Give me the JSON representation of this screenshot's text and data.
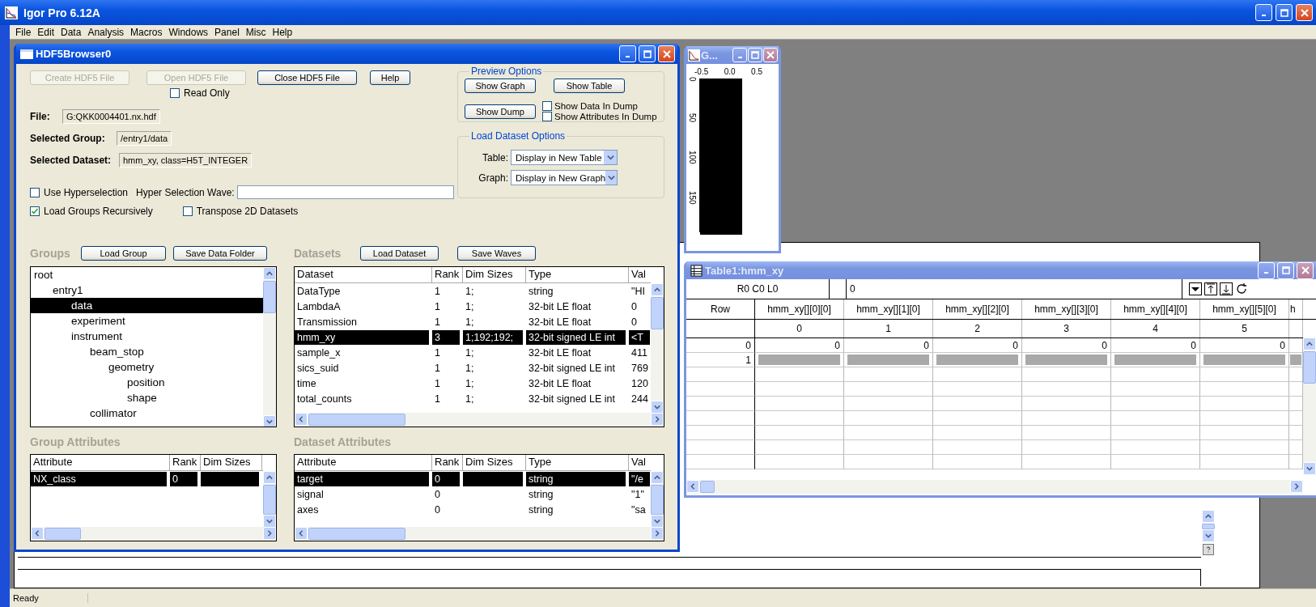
{
  "app": {
    "title": "Igor Pro 6.12A",
    "menu": [
      "File",
      "Edit",
      "Data",
      "Analysis",
      "Macros",
      "Windows",
      "Panel",
      "Misc",
      "Help"
    ]
  },
  "browser": {
    "title": "HDF5Browser0",
    "buttons": [
      {
        "label": "Create HDF5 File",
        "disabled": true
      },
      {
        "label": "Open HDF5 File",
        "disabled": true
      },
      {
        "label": "Close HDF5 File",
        "disabled": false
      },
      {
        "label": "Help",
        "disabled": false
      }
    ],
    "read_only": {
      "label": "Read Only",
      "checked": false
    },
    "fields": [
      {
        "label": "File:",
        "value": "G:QKK0004401.nx.hdf"
      },
      {
        "label": "Selected Group:",
        "value": "/entry1/data"
      },
      {
        "label": "Selected Dataset:",
        "value": "hmm_xy, class=H5T_INTEGER"
      }
    ],
    "use_hyperselection": {
      "label": "Use Hyperselection",
      "checked": false
    },
    "hyper_wave": {
      "label": "Hyper Selection Wave:"
    },
    "load_groups_recursively": {
      "label": "Load Groups Recursively",
      "checked": true
    },
    "transpose": {
      "label": "Transpose 2D Datasets",
      "checked": false
    },
    "preview_options": {
      "title": "Preview Options",
      "buttons": [
        "Show Graph",
        "Show Table",
        "Show Dump"
      ],
      "checkboxes": [
        {
          "label": "Show Data In Dump",
          "checked": false
        },
        {
          "label": "Show Attributes In Dump",
          "checked": false
        }
      ]
    },
    "load_options": {
      "title": "Load Dataset Options",
      "rows": [
        {
          "label": "Table:",
          "value": "Display in New Table"
        },
        {
          "label": "Graph:",
          "value": "Display in New Graph"
        }
      ]
    },
    "groups": {
      "title": "Groups",
      "buttons": [
        "Load Group",
        "Save Data Folder"
      ],
      "tree": [
        {
          "label": "root",
          "selected": false,
          "children": [
            {
              "label": "entry1",
              "selected": false,
              "children": [
                {
                  "label": "data",
                  "selected": true
                },
                {
                  "label": "experiment",
                  "selected": false
                },
                {
                  "label": "instrument",
                  "selected": false,
                  "children": [
                    {
                      "label": "beam_stop",
                      "selected": false,
                      "children": [
                        {
                          "label": "geometry",
                          "selected": false,
                          "children": [
                            {
                              "label": "position",
                              "selected": false
                            },
                            {
                              "label": "shape",
                              "selected": false
                            }
                          ]
                        }
                      ]
                    },
                    {
                      "label": "collimator",
                      "selected": false
                    }
                  ]
                }
              ]
            }
          ]
        }
      ]
    },
    "datasets": {
      "title": "Datasets",
      "buttons": [
        "Load Dataset",
        "Save Waves"
      ],
      "columns": [
        "Dataset",
        "Rank",
        "Dim Sizes",
        "Type",
        "Val"
      ],
      "rows": [
        {
          "cells": [
            "DataType",
            "1",
            "1;",
            "string",
            "\"HI"
          ],
          "selected": false
        },
        {
          "cells": [
            "LambdaA",
            "1",
            "1;",
            "32-bit LE float",
            "0"
          ],
          "selected": false
        },
        {
          "cells": [
            "Transmission",
            "1",
            "1;",
            "32-bit LE float",
            "0"
          ],
          "selected": false
        },
        {
          "cells": [
            "hmm_xy",
            "3",
            "1;192;192;",
            "32-bit signed LE int",
            "<T"
          ],
          "selected": true
        },
        {
          "cells": [
            "sample_x",
            "1",
            "1;",
            "32-bit LE float",
            "411"
          ],
          "selected": false
        },
        {
          "cells": [
            "sics_suid",
            "1",
            "1;",
            "32-bit signed LE int",
            "769"
          ],
          "selected": false
        },
        {
          "cells": [
            "time",
            "1",
            "1;",
            "32-bit LE float",
            "120"
          ],
          "selected": false
        },
        {
          "cells": [
            "total_counts",
            "1",
            "1;",
            "32-bit signed LE int",
            "244"
          ],
          "selected": false
        }
      ]
    },
    "group_attributes": {
      "title": "Group Attributes",
      "columns": [
        "Attribute",
        "Rank",
        "Dim Sizes"
      ],
      "rows": [
        {
          "cells": [
            "NX_class",
            "0"
          ],
          "selected": true
        }
      ]
    },
    "dataset_attributes": {
      "title": "Dataset Attributes",
      "columns": [
        "Attribute",
        "Rank",
        "Dim Sizes",
        "Type",
        "Val"
      ],
      "rows": [
        {
          "cells": [
            "target",
            "0",
            "",
            "string",
            "\"/e"
          ],
          "selected": true
        },
        {
          "cells": [
            "signal",
            "0",
            "",
            "string",
            "\"1\""
          ],
          "selected": false
        },
        {
          "cells": [
            "axes",
            "0",
            "",
            "string",
            "\"sa"
          ],
          "selected": false
        }
      ]
    }
  },
  "graph": {
    "title": "G...",
    "x_ticks": [
      "-0.5",
      "0.0",
      "0.5"
    ],
    "y_ticks": [
      "0",
      "50",
      "100",
      "150"
    ]
  },
  "table": {
    "title": "Table1:hmm_xy",
    "cell_info": "R0 C0 L0",
    "entry": "0",
    "row_header": "Row",
    "columns": [
      {
        "name": "hmm_xy[][0][0]",
        "index": "0"
      },
      {
        "name": "hmm_xy[][1][0]",
        "index": "1"
      },
      {
        "name": "hmm_xy[][2][0]",
        "index": "2"
      },
      {
        "name": "hmm_xy[][3][0]",
        "index": "3"
      },
      {
        "name": "hmm_xy[][4][0]",
        "index": "4"
      },
      {
        "name": "hmm_xy[][5][0]",
        "index": "5"
      },
      {
        "name": "h"
      }
    ],
    "rows": [
      {
        "label": "0",
        "values": [
          "0",
          "0",
          "0",
          "0",
          "0",
          "0"
        ],
        "selected": false
      },
      {
        "label": "1",
        "selected": true
      }
    ]
  },
  "status_bar": {
    "text": "Ready"
  }
}
